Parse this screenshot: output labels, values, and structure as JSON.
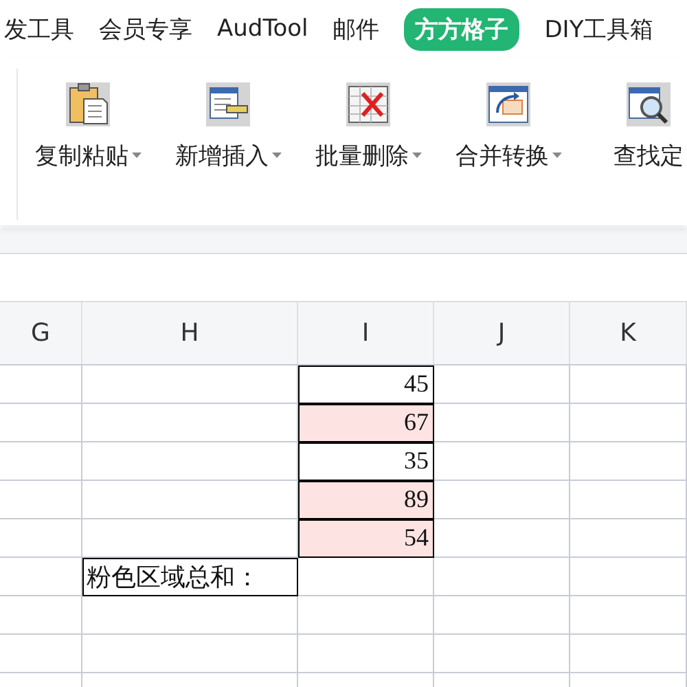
{
  "menu_tabs": [
    {
      "label": "发工具",
      "selected": false
    },
    {
      "label": "会员专享",
      "selected": false
    },
    {
      "label": "AudTool",
      "selected": false
    },
    {
      "label": "邮件",
      "selected": false
    },
    {
      "label": "方方格子",
      "selected": true
    },
    {
      "label": "DIY工具箱",
      "selected": false
    }
  ],
  "ribbon_buttons": [
    {
      "kind": "clipboard",
      "label": "复制粘贴",
      "dropdown": true
    },
    {
      "kind": "insert",
      "label": "新增插入",
      "dropdown": true
    },
    {
      "kind": "delete",
      "label": "批量删除",
      "dropdown": true
    },
    {
      "kind": "convert",
      "label": "合并转换",
      "dropdown": true
    },
    {
      "kind": "find",
      "label": "查找定",
      "dropdown": false
    }
  ],
  "sheet": {
    "columns": [
      "G",
      "H",
      "I",
      "J",
      "K"
    ],
    "rows": [
      {
        "cells": [
          {},
          {},
          {
            "text": "45",
            "highlighted": false,
            "bordered": true
          },
          {},
          {}
        ]
      },
      {
        "cells": [
          {},
          {},
          {
            "text": "67",
            "highlighted": true,
            "bordered": true
          },
          {},
          {}
        ]
      },
      {
        "cells": [
          {},
          {},
          {
            "text": "35",
            "highlighted": false,
            "bordered": true
          },
          {},
          {}
        ]
      },
      {
        "cells": [
          {},
          {},
          {
            "text": "89",
            "highlighted": true,
            "bordered": true
          },
          {},
          {}
        ]
      },
      {
        "cells": [
          {},
          {},
          {
            "text": "54",
            "highlighted": true,
            "bordered": true
          },
          {},
          {}
        ]
      },
      {
        "cells": [
          {},
          {
            "text": "粉色区域总和：",
            "highlighted": false,
            "bordered": true
          },
          {},
          {},
          {}
        ]
      },
      {
        "cells": [
          {},
          {},
          {},
          {},
          {}
        ]
      },
      {
        "cells": [
          {},
          {},
          {},
          {},
          {}
        ]
      },
      {
        "cells": [
          {},
          {},
          {},
          {},
          {}
        ]
      }
    ]
  }
}
